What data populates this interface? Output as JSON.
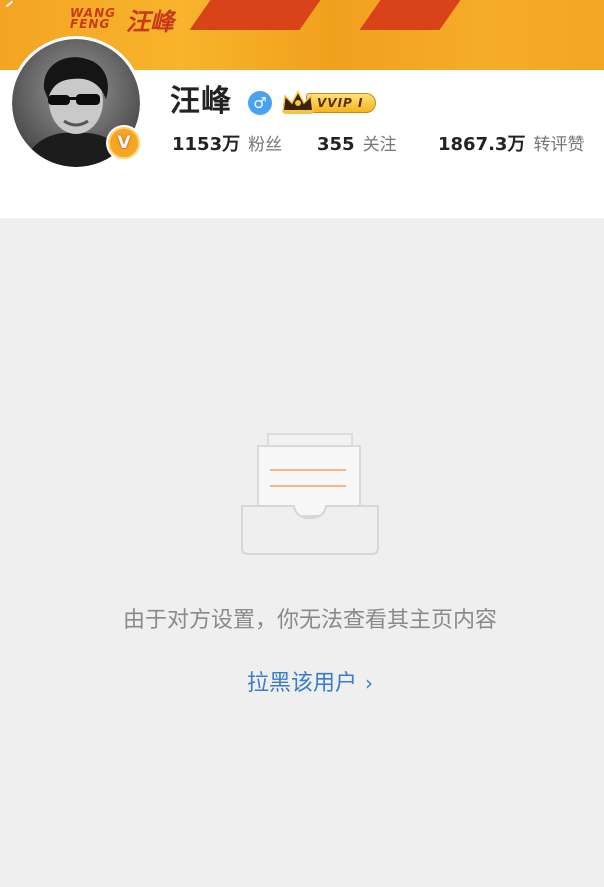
{
  "banner": {
    "logo_text_en_line1": "WANG",
    "logo_text_en_line2": "FENG",
    "logo_text_cn": "汪峰"
  },
  "profile": {
    "name": "汪峰",
    "gender_symbol": "♂",
    "vip_label": "VVIP I",
    "verified_symbol": "V",
    "stats": [
      {
        "value": "1153万",
        "label": "粉丝"
      },
      {
        "value": "355",
        "label": "关注"
      },
      {
        "value": "1867.3万",
        "label": "转评赞"
      }
    ]
  },
  "empty_state": {
    "message": "由于对方设置，你无法查看其主页内容",
    "block_link": "拉黑该用户",
    "block_link_chevron": "›"
  },
  "colors": {
    "banner_orange": "#f4a422",
    "banner_red": "#d8431a",
    "link_blue": "#3a7dc9",
    "gender_blue": "#4aa3f2",
    "verified_gold": "#f5a623",
    "background_gray": "#efefef"
  },
  "icons": {
    "gender": "male-gender-icon",
    "vip": "crown-icon",
    "verified": "verified-v-icon",
    "empty": "empty-inbox-icon",
    "chevron": "chevron-right-icon"
  }
}
